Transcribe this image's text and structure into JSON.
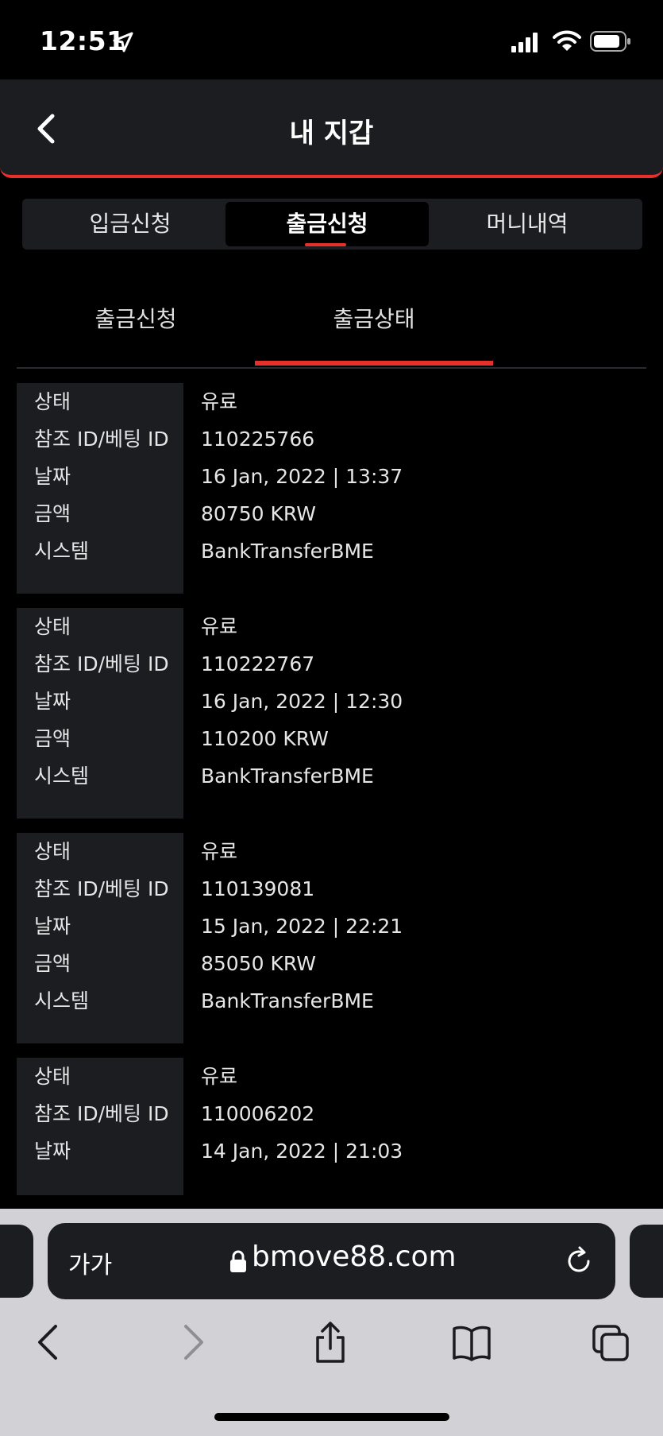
{
  "status_bar": {
    "time": "12:51"
  },
  "header": {
    "title": "내 지갑"
  },
  "main_tabs": [
    {
      "label": "입금신청"
    },
    {
      "label": "출금신청"
    },
    {
      "label": "머니내역"
    }
  ],
  "sub_tabs": [
    {
      "label": "출금신청"
    },
    {
      "label": "출금상태"
    }
  ],
  "labels": {
    "status": "상태",
    "ref_id": "참조 ID/베팅 ID",
    "date": "날짜",
    "amount": "금액",
    "system": "시스템"
  },
  "records": [
    {
      "status": "유료",
      "ref_id": "110225766",
      "date": "16 Jan, 2022 | 13:37",
      "amount": "80750 KRW",
      "system": "BankTransferBME"
    },
    {
      "status": "유료",
      "ref_id": "110222767",
      "date": "16 Jan, 2022 | 12:30",
      "amount": "110200 KRW",
      "system": "BankTransferBME"
    },
    {
      "status": "유료",
      "ref_id": "110139081",
      "date": "15 Jan, 2022 | 22:21",
      "amount": "85050 KRW",
      "system": "BankTransferBME"
    },
    {
      "status": "유료",
      "ref_id": "110006202",
      "date": "14 Jan, 2022 | 21:03"
    }
  ],
  "browser": {
    "text_size_label": "가가",
    "url": "bmove88.com"
  },
  "colors": {
    "accent": "#e8302a",
    "panel": "#1c1d21",
    "background": "#000000",
    "browser_chrome": "#d1d1d6"
  }
}
